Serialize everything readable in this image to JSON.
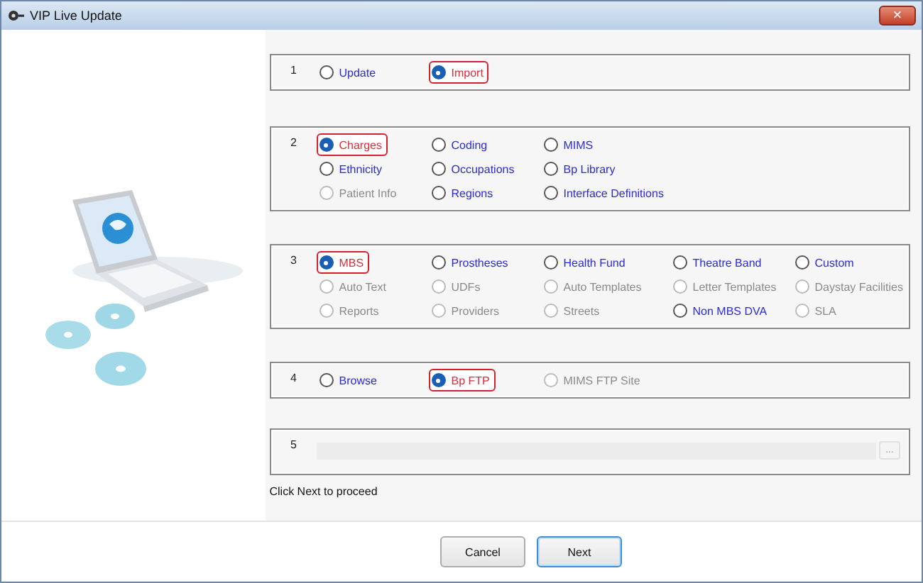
{
  "window": {
    "title": "VIP Live Update",
    "close": "×"
  },
  "sections": [
    {
      "number": "1",
      "rows": [
        [
          {
            "label": "Update",
            "selected": false,
            "disabled": false
          },
          {
            "label": "Import",
            "selected": true,
            "disabled": false
          }
        ]
      ]
    },
    {
      "number": "2",
      "rows": [
        [
          {
            "label": "Charges",
            "selected": true,
            "disabled": false
          },
          {
            "label": "Coding",
            "selected": false,
            "disabled": false
          },
          {
            "label": "MIMS",
            "selected": false,
            "disabled": false
          }
        ],
        [
          {
            "label": "Ethnicity",
            "selected": false,
            "disabled": false
          },
          {
            "label": "Occupations",
            "selected": false,
            "disabled": false
          },
          {
            "label": "Bp Library",
            "selected": false,
            "disabled": false
          }
        ],
        [
          {
            "label": "Patient Info",
            "selected": false,
            "disabled": true
          },
          {
            "label": "Regions",
            "selected": false,
            "disabled": false
          },
          {
            "label": "Interface Definitions",
            "selected": false,
            "disabled": false
          }
        ]
      ]
    },
    {
      "number": "3",
      "rows": [
        [
          {
            "label": "MBS",
            "selected": true,
            "disabled": false
          },
          {
            "label": "Prostheses",
            "selected": false,
            "disabled": false
          },
          {
            "label": "Health Fund",
            "selected": false,
            "disabled": false
          },
          {
            "label": "Theatre Band",
            "selected": false,
            "disabled": false
          },
          {
            "label": "Custom",
            "selected": false,
            "disabled": false
          }
        ],
        [
          {
            "label": "Auto Text",
            "selected": false,
            "disabled": true
          },
          {
            "label": "UDFs",
            "selected": false,
            "disabled": true
          },
          {
            "label": "Auto Templates",
            "selected": false,
            "disabled": true
          },
          {
            "label": "Letter Templates",
            "selected": false,
            "disabled": true
          },
          {
            "label": "Daystay Facilities",
            "selected": false,
            "disabled": true
          }
        ],
        [
          {
            "label": "Reports",
            "selected": false,
            "disabled": true
          },
          {
            "label": "Providers",
            "selected": false,
            "disabled": true
          },
          {
            "label": "Streets",
            "selected": false,
            "disabled": true
          },
          {
            "label": "Non MBS DVA",
            "selected": false,
            "disabled": false
          },
          {
            "label": "SLA",
            "selected": false,
            "disabled": true
          }
        ]
      ]
    },
    {
      "number": "4",
      "rows": [
        [
          {
            "label": "Browse",
            "selected": false,
            "disabled": false
          },
          {
            "label": "Bp FTP",
            "selected": true,
            "disabled": false
          },
          {
            "label": "MIMS FTP Site",
            "selected": false,
            "disabled": true
          }
        ]
      ]
    },
    {
      "number": "5",
      "path": {
        "disabled": true,
        "browse": "..."
      }
    }
  ],
  "hint": "Click Next to proceed",
  "buttons": [
    {
      "label": "Cancel",
      "default": false
    },
    {
      "label": "Next",
      "default": true
    }
  ]
}
